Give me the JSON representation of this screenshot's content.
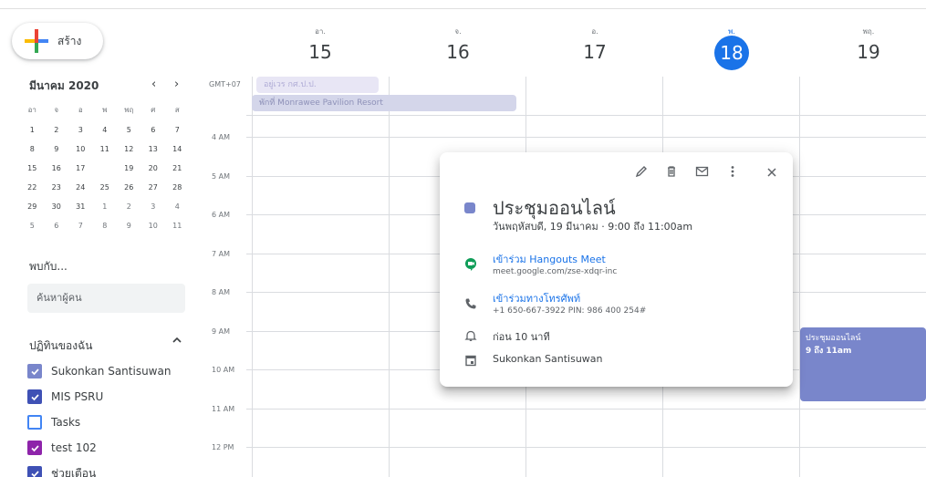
{
  "create_button": {
    "label": "สร้าง"
  },
  "mini_calendar": {
    "month_title": "มีนาคม 2020",
    "prev": "‹",
    "next": "›",
    "weekdays": [
      "อา",
      "จ",
      "อ",
      "พ",
      "พฤ",
      "ศ",
      "ส"
    ],
    "weeks": [
      [
        {
          "d": "1"
        },
        {
          "d": "2"
        },
        {
          "d": "3"
        },
        {
          "d": "4"
        },
        {
          "d": "5"
        },
        {
          "d": "6"
        },
        {
          "d": "7"
        }
      ],
      [
        {
          "d": "8"
        },
        {
          "d": "9"
        },
        {
          "d": "10"
        },
        {
          "d": "11"
        },
        {
          "d": "12"
        },
        {
          "d": "13"
        },
        {
          "d": "14"
        }
      ],
      [
        {
          "d": "15"
        },
        {
          "d": "16"
        },
        {
          "d": "17"
        },
        {
          "d": "18",
          "today": true
        },
        {
          "d": "19"
        },
        {
          "d": "20"
        },
        {
          "d": "21"
        }
      ],
      [
        {
          "d": "22"
        },
        {
          "d": "23"
        },
        {
          "d": "24"
        },
        {
          "d": "25"
        },
        {
          "d": "26"
        },
        {
          "d": "27"
        },
        {
          "d": "28"
        }
      ],
      [
        {
          "d": "29"
        },
        {
          "d": "30"
        },
        {
          "d": "31"
        },
        {
          "d": "1",
          "dim": true
        },
        {
          "d": "2",
          "dim": true
        },
        {
          "d": "3",
          "dim": true
        },
        {
          "d": "4",
          "dim": true
        }
      ],
      [
        {
          "d": "5",
          "dim": true
        },
        {
          "d": "6",
          "dim": true
        },
        {
          "d": "7",
          "dim": true
        },
        {
          "d": "8",
          "dim": true
        },
        {
          "d": "9",
          "dim": true
        },
        {
          "d": "10",
          "dim": true
        },
        {
          "d": "11",
          "dim": true
        }
      ]
    ]
  },
  "meet_with": {
    "title": "พบกับ...",
    "search_placeholder": "ค้นหาผู้คน"
  },
  "my_calendars": {
    "title": "ปฏิทินของฉัน",
    "chevron": "^",
    "items": [
      {
        "label": "Sukonkan Santisuwan",
        "checked": true,
        "color": "#7986cb"
      },
      {
        "label": "MIS PSRU",
        "checked": true,
        "color": "#3f51b5"
      },
      {
        "label": "Tasks",
        "checked": false,
        "color": "#4285f4"
      },
      {
        "label": "test 102",
        "checked": true,
        "color": "#8e24aa"
      },
      {
        "label": "ช่วยเตือน",
        "checked": true,
        "color": "#3f51b5"
      }
    ]
  },
  "week": {
    "timezone": "GMT+07",
    "days": [
      {
        "name": "อา.",
        "num": "15",
        "today": false
      },
      {
        "name": "จ.",
        "num": "16",
        "today": false
      },
      {
        "name": "อ.",
        "num": "17",
        "today": false
      },
      {
        "name": "พ.",
        "num": "18",
        "today": true
      },
      {
        "name": "พฤ.",
        "num": "19",
        "today": false
      }
    ],
    "times": [
      "4 AM",
      "5 AM",
      "6 AM",
      "7 AM",
      "8 AM",
      "9 AM",
      "10 AM",
      "11 AM",
      "12 PM"
    ],
    "allday_events": [
      "อยู่เวร กศ.ป.ป.",
      "พักที่ Monrawee Pavilion Resort"
    ],
    "event": {
      "title": "ประชุมออนไลน์",
      "time": "9 ถึง 11am",
      "color": "#7986cb"
    }
  },
  "popup": {
    "title": "ประชุมออนไลน์",
    "datetime": "วันพฤหัสบดี, 19 มีนาคม  ·  9:00 ถึง 11:00am",
    "hangouts_label": "เข้าร่วม Hangouts Meet",
    "hangouts_url": "meet.google.com/zse-xdqr-inc",
    "phone_label": "เข้าร่วมทางโทรศัพท์",
    "phone_number": "+1 650-667-3922 PIN: 986 400 254#",
    "reminder": "ก่อน 10 นาที",
    "owner": "Sukonkan Santisuwan",
    "icons": [
      "edit-icon",
      "delete-icon",
      "email-icon",
      "more-icon",
      "close-icon"
    ]
  }
}
